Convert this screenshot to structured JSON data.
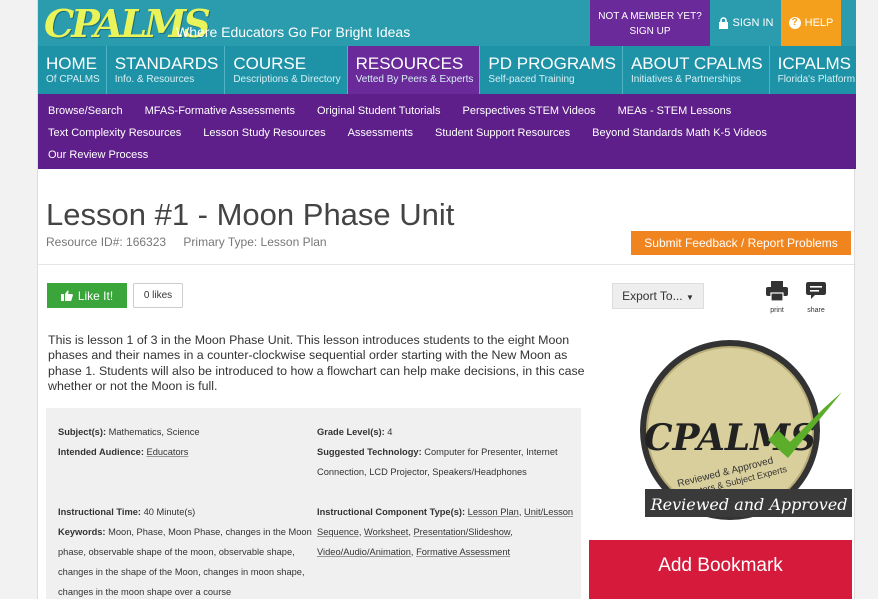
{
  "brand": {
    "logo": "CPALMS",
    "tagline": "Where Educators Go For Bright Ideas"
  },
  "top_actions": {
    "not_member": "NOT A MEMBER YET?",
    "sign_up": "SIGN UP",
    "sign_in": "SIGN IN",
    "help": "HELP"
  },
  "main_nav": [
    {
      "title": "HOME",
      "sub": "Of CPALMS"
    },
    {
      "title": "STANDARDS",
      "sub": "Info. & Resources"
    },
    {
      "title": "COURSE",
      "sub": "Descriptions & Directory"
    },
    {
      "title": "RESOURCES",
      "sub": "Vetted By Peers & Experts"
    },
    {
      "title": "PD PROGRAMS",
      "sub": "Self-paced Training"
    },
    {
      "title": "ABOUT CPALMS",
      "sub": "Initiatives & Partnerships"
    },
    {
      "title": "ICPALMS",
      "sub": "Florida's Platform"
    }
  ],
  "sub_nav": {
    "row1": [
      "Browse/Search",
      "MFAS-Formative Assessments",
      "Original Student Tutorials",
      "Perspectives STEM Videos",
      "MEAs - STEM Lessons"
    ],
    "row2": [
      "Text Complexity Resources",
      "Lesson Study Resources",
      "Assessments",
      "Student Support Resources",
      "Beyond Standards Math K-5 Videos"
    ],
    "row3": [
      "Our Review Process"
    ]
  },
  "resource": {
    "title": "Lesson #1 - Moon Phase Unit",
    "id_label": "Resource ID#: 166323",
    "type_label": "Primary Type: Lesson Plan",
    "feedback": "Submit Feedback / Report Problems"
  },
  "actions": {
    "like": "Like It!",
    "likes": "0 likes",
    "export": "Export To...",
    "print": "print",
    "share": "share"
  },
  "description": "This is lesson 1 of 3 in the Moon Phase Unit. This lesson introduces students to the eight Moon phases and their names in a counter-clockwise sequential order starting with the New Moon as phase 1. Students will also be introduced to how a flowchart can help make decisions, in this case whether or not the Moon is full.",
  "details": {
    "subjects_label": "Subject(s):",
    "subjects": "Mathematics, Science",
    "audience_label": "Intended Audience:",
    "audience": "Educators",
    "time_label": "Instructional Time:",
    "time": "40 Minute(s)",
    "keywords_label": "Keywords:",
    "keywords": "Moon, Phase, Moon Phase, changes in the Moon phase, observable shape of the moon, observable shape, changes in the shape of the Moon, changes in moon shape, changes in the moon shape over a course",
    "grade_label": "Grade Level(s):",
    "grade": "4",
    "tech_label": "Suggested Technology:",
    "tech": "Computer for Presenter, Internet Connection, LCD Projector, Speakers/Headphones",
    "component_label": "Instructional Component Type(s):",
    "components": [
      "Lesson Plan",
      "Unit/Lesson Sequence",
      "Worksheet",
      "Presentation/Slideshow",
      "Video/Audio/Animation",
      "Formative Assessment"
    ]
  },
  "badge": {
    "logo": "CPALMS",
    "line1": "Reviewed & Approved",
    "line2": "by Educators & Subject Experts",
    "banner": "Reviewed and Approved"
  },
  "bookmark": "Add Bookmark",
  "colors": {
    "teal": "#2a9cae",
    "purple": "#5e1f8a",
    "orange": "#f0851f",
    "green": "#3aa53a",
    "red": "#d51a3c"
  }
}
